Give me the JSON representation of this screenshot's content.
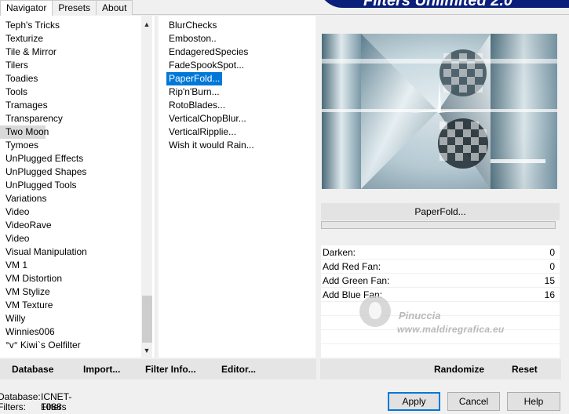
{
  "tabs": [
    "Navigator",
    "Presets",
    "About"
  ],
  "banner_title": "Filters Unlimited 2.0",
  "categories": [
    "Teph's Tricks",
    "Texturize",
    "Tile & Mirror",
    "Tilers",
    "Toadies",
    "Tools",
    "Tramages",
    "Transparency",
    "Two Moon",
    "Tymoes",
    "UnPlugged Effects",
    "UnPlugged Shapes",
    "UnPlugged Tools",
    "Variations",
    "Video",
    "VideoRave",
    "Video",
    "Visual Manipulation",
    "VM 1",
    "VM Distortion",
    "VM Stylize",
    "VM Texture",
    "Willy",
    "Winnies006",
    "°v° Kiwi`s Oelfilter"
  ],
  "selected_category": "Two Moon",
  "filters": [
    "BlurChecks",
    "Emboston..",
    "EndageredSpecies",
    "FadeSpookSpot...",
    "PaperFold...",
    "Rip'n'Burn...",
    "RotoBlades...",
    "VerticalChopBlur...",
    "VerticalRipplie...",
    "Wish it would Rain..."
  ],
  "selected_filter": "PaperFold...",
  "filter_title": "PaperFold...",
  "params": [
    {
      "label": "Darken:",
      "value": "0"
    },
    {
      "label": "Add Red Fan:",
      "value": "0"
    },
    {
      "label": "Add Green Fan:",
      "value": "15"
    },
    {
      "label": "Add Blue Fan:",
      "value": "16"
    }
  ],
  "watermark": {
    "name": "Pinuccia",
    "url": "www.maldiregrafica.eu"
  },
  "left_buttons": [
    "Database",
    "Import...",
    "Filter Info...",
    "Editor..."
  ],
  "right_buttons": [
    "Randomize",
    "Reset"
  ],
  "footer": {
    "database_label": "Database:",
    "database_value": "ICNET-Filters",
    "filters_label": "Filters:",
    "filters_value": "1088"
  },
  "dialog_buttons": {
    "apply": "Apply",
    "cancel": "Cancel",
    "help": "Help"
  }
}
